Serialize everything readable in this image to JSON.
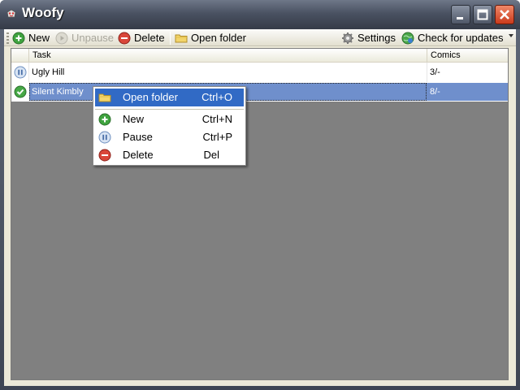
{
  "window": {
    "title": "Woofy"
  },
  "toolbar": {
    "new_label": "New",
    "unpause_label": "Unpause",
    "delete_label": "Delete",
    "open_folder_label": "Open folder",
    "settings_label": "Settings",
    "check_updates_label": "Check for updates"
  },
  "list": {
    "columns": [
      "Task",
      "Comics"
    ],
    "rows": [
      {
        "state": "paused",
        "task": "Ugly Hill",
        "comics": "3/-"
      },
      {
        "state": "ok",
        "task": "Silent Kimbly",
        "comics": "8/-"
      }
    ]
  },
  "context_menu": {
    "items": [
      {
        "label": "Open folder",
        "shortcut": "Ctrl+O",
        "icon": "folder-icon"
      },
      {
        "label": "New",
        "shortcut": "Ctrl+N",
        "icon": "add-icon"
      },
      {
        "label": "Pause",
        "shortcut": "Ctrl+P",
        "icon": "pause-icon"
      },
      {
        "label": "Delete",
        "shortcut": "Del",
        "icon": "delete-icon"
      }
    ]
  },
  "colors": {
    "selection": "#6f8fcc",
    "menu_highlight": "#316ac5",
    "list_background": "#808080"
  }
}
